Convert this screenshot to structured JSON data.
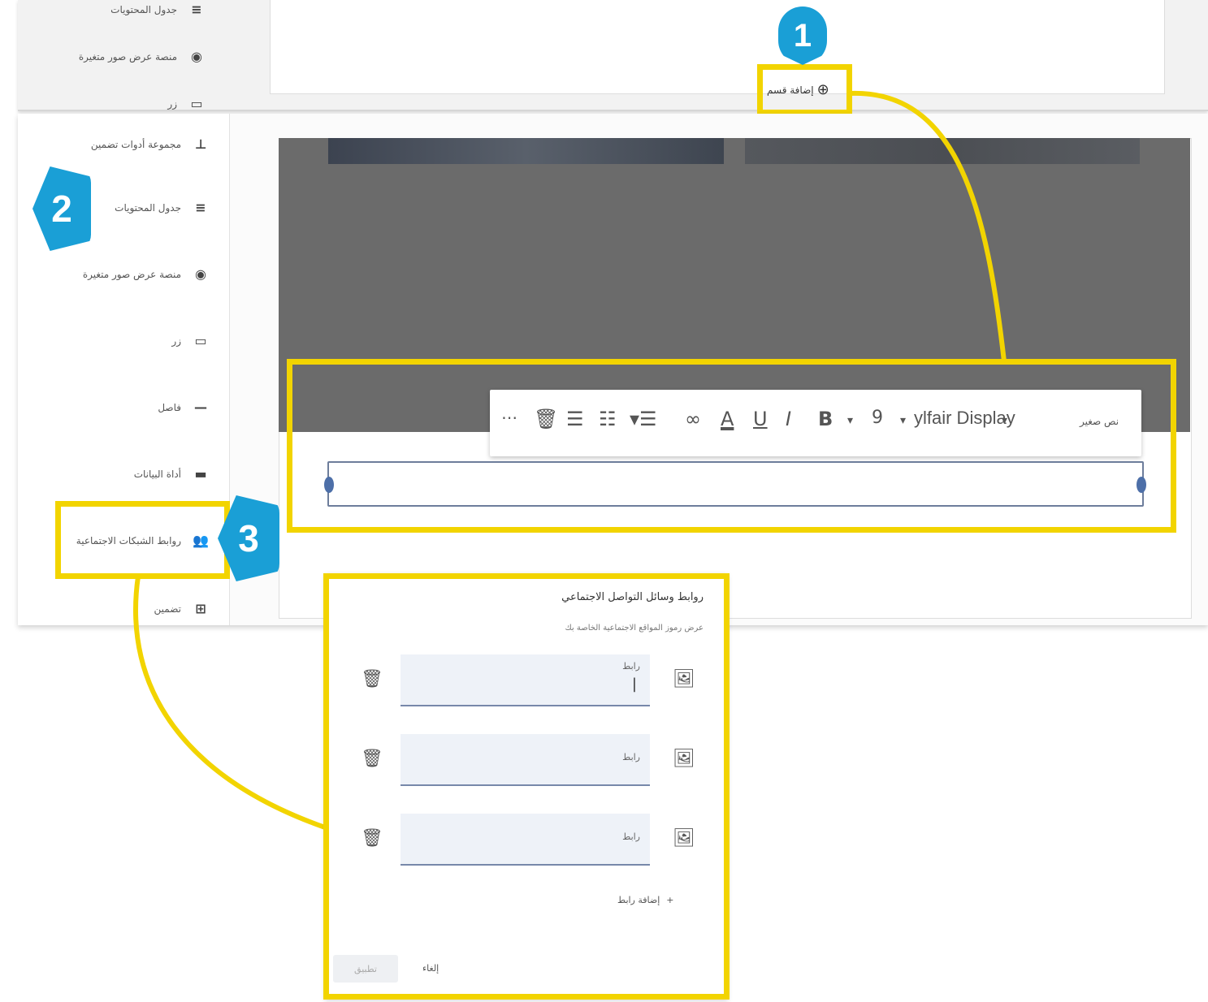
{
  "callouts": [
    "1",
    "2",
    "3"
  ],
  "top_panel": {
    "sidebar_items": [
      {
        "label": "جدول المحتويات",
        "icon": "≡"
      },
      {
        "label": "منصة عرض صور متغيرة",
        "icon": "◉"
      },
      {
        "label": "زر",
        "icon": "▭"
      }
    ],
    "add_section_label": "إضافة قسم"
  },
  "sidebar": {
    "items": [
      {
        "label": "مجموعة أدوات تضمين",
        "icon": "⊥"
      },
      {
        "label": "جدول المحتويات",
        "icon": "≡"
      },
      {
        "label": "منصة عرض صور متغيرة",
        "icon": "◉"
      },
      {
        "label": "زر",
        "icon": "▭"
      },
      {
        "label": "فاصل",
        "icon": "—"
      },
      {
        "label": "أداة البيانات",
        "icon": "▬"
      },
      {
        "label": "روابط الشبكات الاجتماعية",
        "icon": "👥"
      },
      {
        "label": "تضمين",
        "icon": "⊞"
      }
    ]
  },
  "toolbar": {
    "style_label": "نص صغير",
    "font_label": "ylfair Display",
    "font_size": "9",
    "icons": [
      "more-icon",
      "trash-icon",
      "align-icon",
      "numbered-list-icon",
      "bulleted-list-icon",
      "link-icon",
      "font-color-icon",
      "underline-icon",
      "italic-icon",
      "bold-icon"
    ]
  },
  "dialog": {
    "title": "روابط وسائل التواصل الاجتماعي",
    "subtitle": "عرض رموز المواقع الاجتماعية الخاصة بك",
    "fields": [
      {
        "label": "رابط",
        "value": "|"
      },
      {
        "label": "رابط",
        "value": ""
      },
      {
        "label": "رابط",
        "value": ""
      }
    ],
    "add_link_label": "إضافة رابط",
    "cancel_label": "إلغاء",
    "apply_label": "تطبيق"
  },
  "colors": {
    "highlight": "#f2d400",
    "badge": "#1a9fd6",
    "banner": "#6b6b6b"
  }
}
